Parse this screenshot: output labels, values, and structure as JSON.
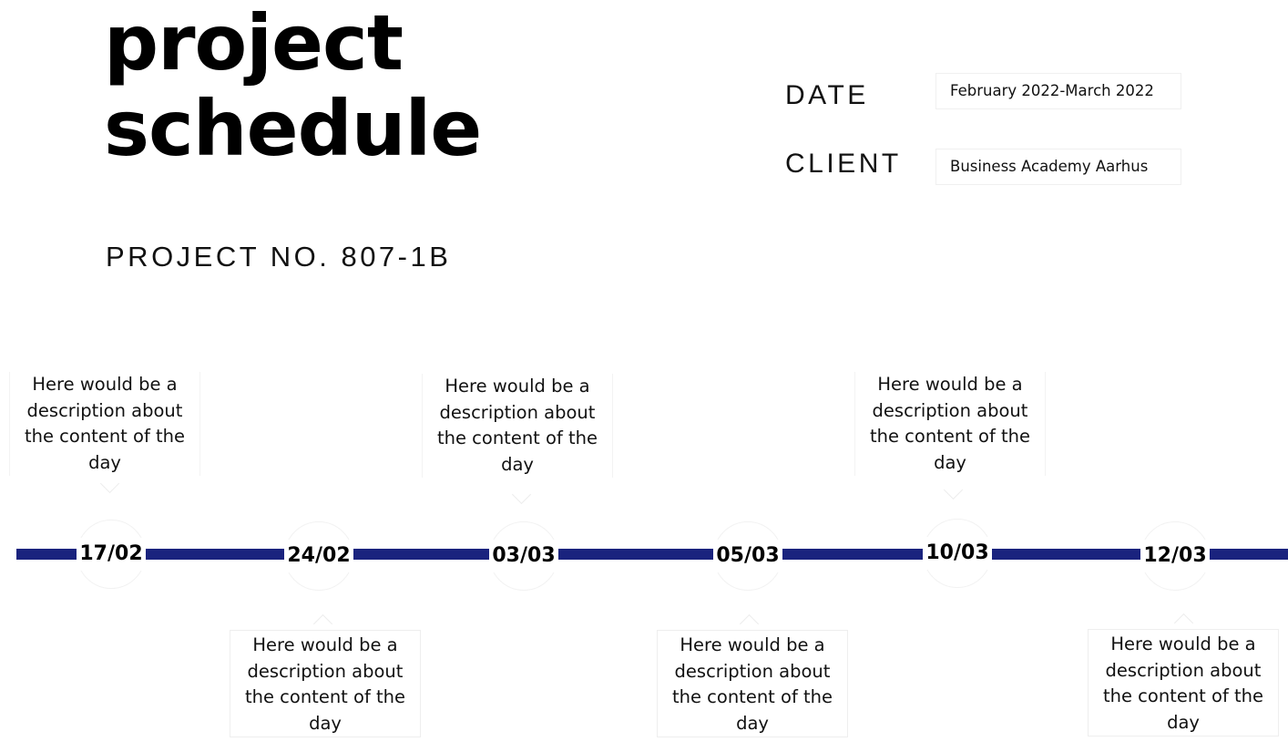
{
  "title": {
    "line1": "project",
    "line2": "schedule"
  },
  "project_no": "PROJECT NO. 807-1B",
  "meta": {
    "date_label": "DATE",
    "date_value": "February 2022-March 2022",
    "client_label": "CLIENT",
    "client_value": "Business Academy Aarhus"
  },
  "colors": {
    "timeline": "#1a237e"
  },
  "milestones": [
    {
      "date": "17/02",
      "position": "above",
      "description": "Here would be a description about the content of the day"
    },
    {
      "date": "24/02",
      "position": "below",
      "description": "Here would be a description about the content of the day"
    },
    {
      "date": "03/03",
      "position": "above",
      "description": "Here would be a description about the content of the day"
    },
    {
      "date": "05/03",
      "position": "below",
      "description": "Here would be a description about the content of the day"
    },
    {
      "date": "10/03",
      "position": "above",
      "description": "Here would be a description about the content of the day"
    },
    {
      "date": "12/03",
      "position": "below",
      "description": "Here would be a description about the content of the day"
    }
  ]
}
